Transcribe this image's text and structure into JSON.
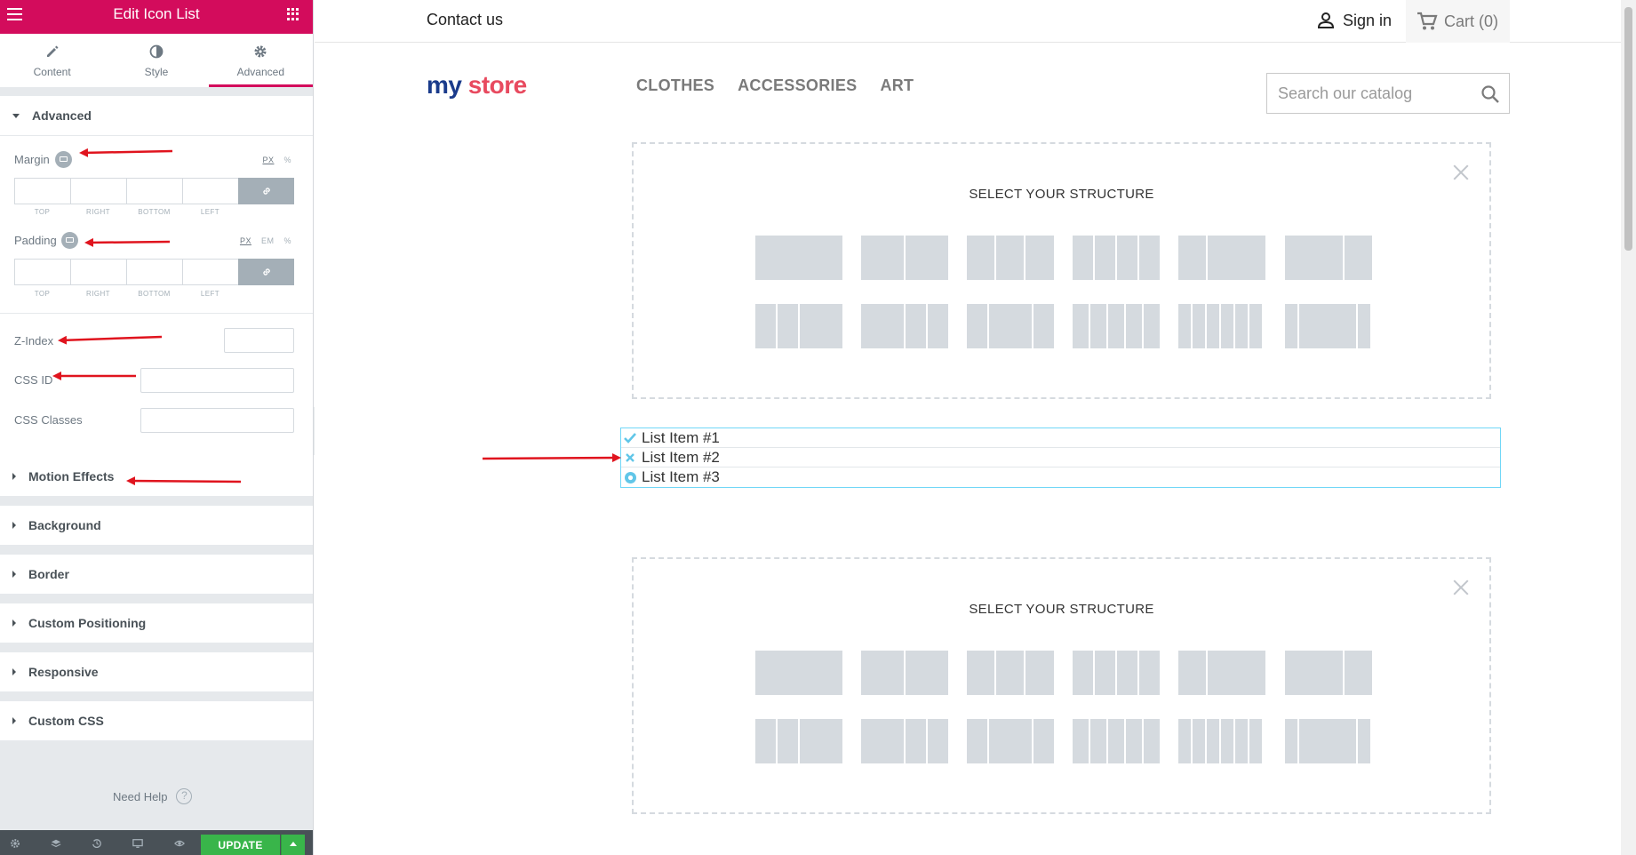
{
  "panel": {
    "title": "Edit Icon List",
    "tabs": [
      {
        "label": "Content",
        "icon": "pencil-icon"
      },
      {
        "label": "Style",
        "icon": "half-circle-icon"
      },
      {
        "label": "Advanced",
        "icon": "gear-icon"
      }
    ],
    "advanced_section": "Advanced",
    "margin": {
      "label": "Margin",
      "units": [
        "PX",
        "%"
      ],
      "selected_unit": "PX",
      "sides": [
        "TOP",
        "RIGHT",
        "BOTTOM",
        "LEFT"
      ]
    },
    "padding": {
      "label": "Padding",
      "units": [
        "PX",
        "EM",
        "%"
      ],
      "selected_unit": "PX",
      "sides": [
        "TOP",
        "RIGHT",
        "BOTTOM",
        "LEFT"
      ]
    },
    "z_index_label": "Z-Index",
    "css_id_label": "CSS ID",
    "css_classes_label": "CSS Classes",
    "sections": [
      "Motion Effects",
      "Background",
      "Border",
      "Custom Positioning",
      "Responsive",
      "Custom CSS"
    ],
    "need_help": "Need Help",
    "update_button": "UPDATE",
    "accent_color": "#d30c5c",
    "update_color": "#39b54a"
  },
  "store": {
    "contact": "Contact us",
    "sign_in": "Sign in",
    "cart": "Cart (0)",
    "logo": {
      "part1": "my",
      "part2": "store"
    },
    "menu": [
      "CLOTHES",
      "ACCESSORIES",
      "ART"
    ],
    "search_placeholder": "Search our catalog",
    "structure_title": "SELECT YOUR STRUCTURE",
    "list_items": [
      {
        "text": "List Item #1",
        "icon": "check-icon"
      },
      {
        "text": "List Item #2",
        "icon": "times-icon"
      },
      {
        "text": "List Item #3",
        "icon": "dot-circle-icon"
      }
    ],
    "list_icon_color": "#61c6e8"
  },
  "annotation_color": "#e0141e"
}
